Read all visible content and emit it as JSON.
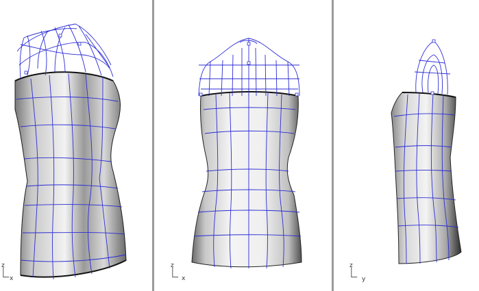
{
  "viewports": [
    {
      "id": "perspective",
      "axis": {
        "vertical": "z",
        "horizontal": "x"
      }
    },
    {
      "id": "front",
      "axis": {
        "vertical": "z",
        "horizontal": "x"
      }
    },
    {
      "id": "right",
      "axis": {
        "vertical": "z",
        "horizontal": "y"
      }
    }
  ],
  "colors": {
    "background": "#ffffff",
    "wire": "#2b2bd6",
    "surface_light": "#f4f4f4",
    "surface_dark": "#3c3c3c",
    "divider": "#9a9a9a",
    "axis": "#333333"
  }
}
